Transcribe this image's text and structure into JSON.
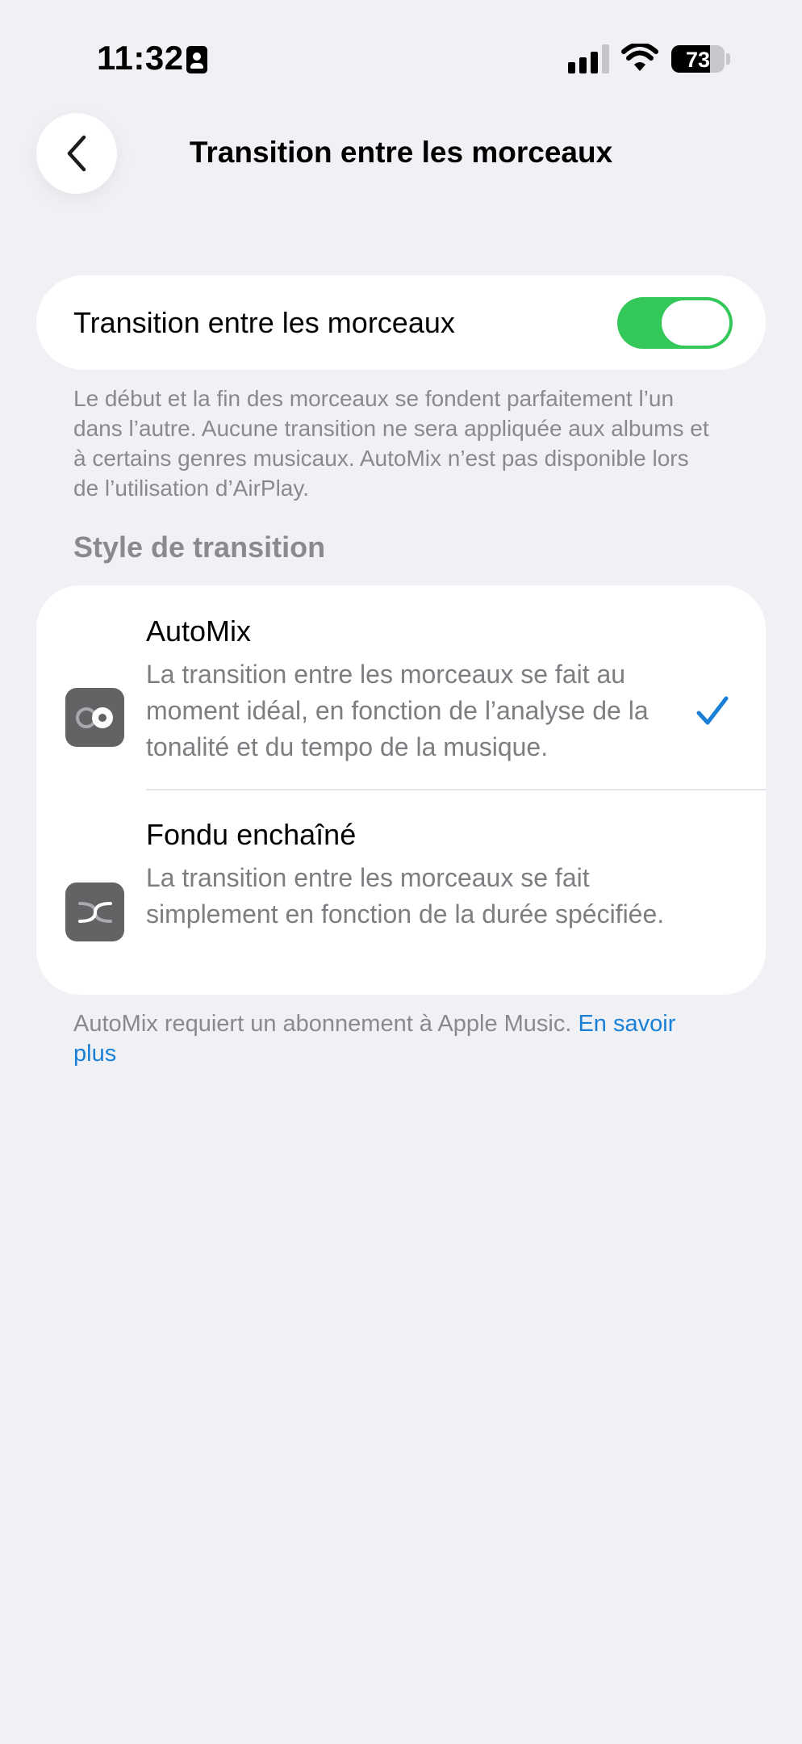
{
  "status_bar": {
    "time": "11:32",
    "battery_percent": "73",
    "battery_level": 0.73,
    "signal_bars_active": 3,
    "signal_bars_total": 4
  },
  "nav": {
    "title": "Transition entre les morceaux",
    "back_icon": "chevron-left-icon"
  },
  "toggle_row": {
    "label": "Transition entre les morceaux",
    "enabled": true,
    "on_color": "#34c759"
  },
  "footnote_top": "Le début et la fin des morceaux se fondent parfaitement l’un dans l’autre. Aucune transition ne sera appliquée aux albums et à certains genres musicaux. AutoMix n’est pas disponible lors de l’utilisation d’AirPlay.",
  "section_header": "Style de transition",
  "options": [
    {
      "title": "AutoMix",
      "description": "La transition entre les morceaux se fait au moment idéal, en fonction de l’analyse de la tonalité et du tempo de la musique.",
      "icon": "automix-icon",
      "selected": true
    },
    {
      "title": "Fondu enchaîné",
      "description": "La transition entre les morceaux se fait simplement en fonction de la durée spécifiée.",
      "icon": "crossfade-icon",
      "selected": false
    }
  ],
  "footnote_bottom": {
    "text": "AutoMix requiert un abonnement à Apple Music. ",
    "link": "En savoir plus"
  },
  "colors": {
    "background": "#f0f1f5",
    "accent": "#1a80d6",
    "secondary_text": "#8a8a8e",
    "icon_tile": "#636366"
  }
}
